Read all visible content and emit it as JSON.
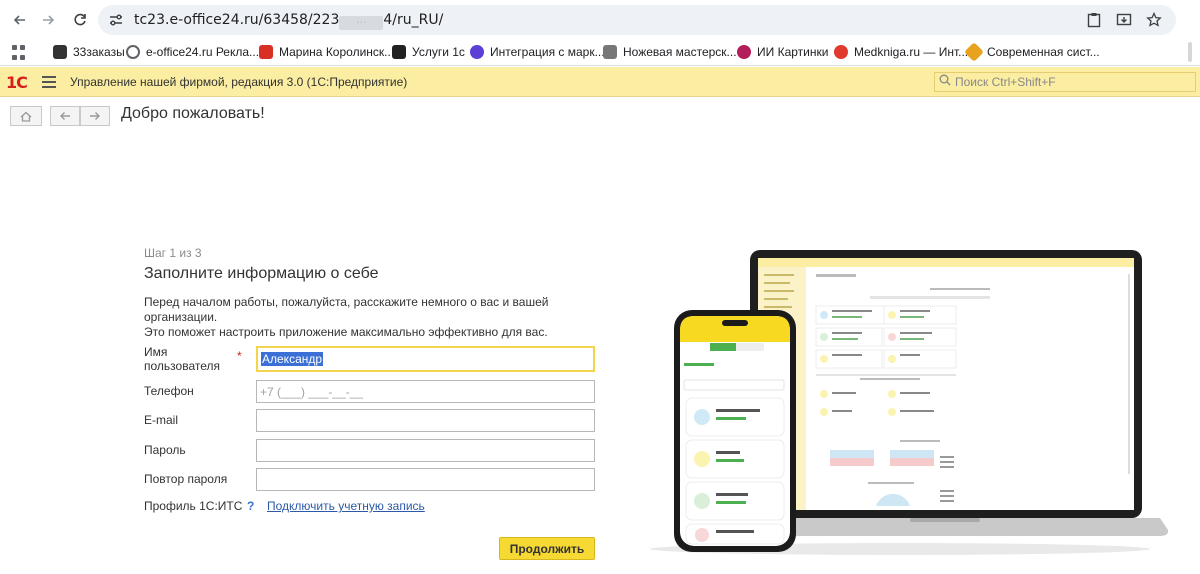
{
  "browser": {
    "url_prefix": "tc23.e-office24.ru/63458/223",
    "url_hidden": "···",
    "url_suffix": "4/ru_RU/",
    "bookmarks": [
      {
        "label": "33заказы",
        "color": "#333333"
      },
      {
        "label": "e-office24.ru Рекла...",
        "color": "#5f6368"
      },
      {
        "label": "Марина Королинск...",
        "color": "#d93025"
      },
      {
        "label": "Услуги 1с",
        "color": "#222222"
      },
      {
        "label": "Интеграция с марк...",
        "color": "#5b3fd6"
      },
      {
        "label": "Ножевая мастерск...",
        "color": "#777777"
      },
      {
        "label": "ИИ Картинки",
        "color": "#b31f5a"
      },
      {
        "label": "Medkniga.ru — Инт...",
        "color": "#e03a2f"
      },
      {
        "label": "Современная сист...",
        "color": "#e8a21b"
      }
    ]
  },
  "app": {
    "logo": "1С",
    "title": "Управление нашей фирмой, редакция 3.0  (1С:Предприятие)",
    "search_placeholder": "Поиск Ctrl+Shift+F"
  },
  "page": {
    "title": "Добро пожаловать!"
  },
  "form": {
    "step": "Шаг 1 из 3",
    "title": "Заполните информацию о себе",
    "description_line1": "Перед началом работы, пожалуйста, расскажите немного о вас и вашей организации.",
    "description_line2": "Это поможет настроить приложение максимально эффективно для вас.",
    "username_label_line1": "Имя",
    "username_label_line2": "пользователя",
    "username_required": "*",
    "username_value": "Александр",
    "phone_label": "Телефон",
    "phone_placeholder": "+7 (___) ___-__-__",
    "email_label": "E-mail",
    "email_value": "",
    "password_label": "Пароль",
    "password_value": "",
    "password_repeat_label": "Повтор пароля",
    "password_repeat_value": "",
    "its_label": "Профиль 1С:ИТС",
    "its_help": "?",
    "its_link": "Подключить учетную запись",
    "continue_button": "Продолжить"
  }
}
